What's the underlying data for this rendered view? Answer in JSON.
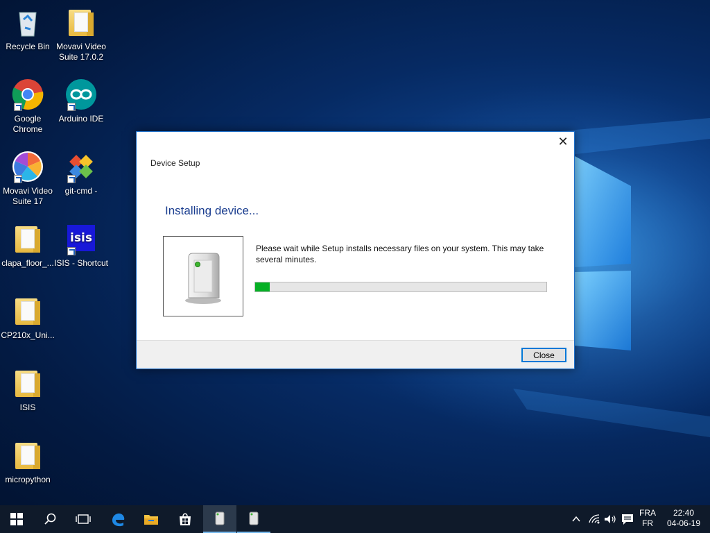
{
  "desktop": {
    "icons": [
      {
        "label": "Recycle Bin",
        "icon": "recycle-bin-icon"
      },
      {
        "label": "Movavi Video Suite 17.0.2",
        "icon": "folder-icon"
      },
      {
        "label": "Google Chrome",
        "icon": "chrome-icon"
      },
      {
        "label": "Arduino IDE",
        "icon": "arduino-icon"
      },
      {
        "label": "Movavi Video Suite 17",
        "icon": "movavi-icon"
      },
      {
        "label": "git-cmd -",
        "icon": "git-icon"
      },
      {
        "label": "clapa_floor_...",
        "icon": "folder-icon"
      },
      {
        "label": "ISIS - Shortcut",
        "icon": "isis-icon"
      },
      {
        "label": "CP210x_Uni...",
        "icon": "folder-icon"
      },
      {
        "label": "ISIS",
        "icon": "folder-icon"
      },
      {
        "label": "micropython",
        "icon": "folder-icon"
      }
    ],
    "isis_logo_text": "isis"
  },
  "dialog": {
    "title": "Device Setup",
    "heading": "Installing device...",
    "message": "Please wait while Setup installs necessary files on your system. This may take several minutes.",
    "progress_fraction": 0.05,
    "close_x": "✕",
    "close_label": "Close",
    "colors": {
      "heading": "#1a3d8f",
      "progress": "#06b025",
      "border": "#1e6fc9"
    }
  },
  "taskbar": {
    "items": [
      "start-icon",
      "search-icon",
      "task-view-icon",
      "edge-icon",
      "file-explorer-icon",
      "store-icon",
      "device-setup-icon",
      "device-setup-icon"
    ],
    "tray": {
      "chevron": "^",
      "lang_top": "FRA",
      "lang_bottom": "FR",
      "time": "22:40",
      "date": "04-06-19"
    }
  }
}
